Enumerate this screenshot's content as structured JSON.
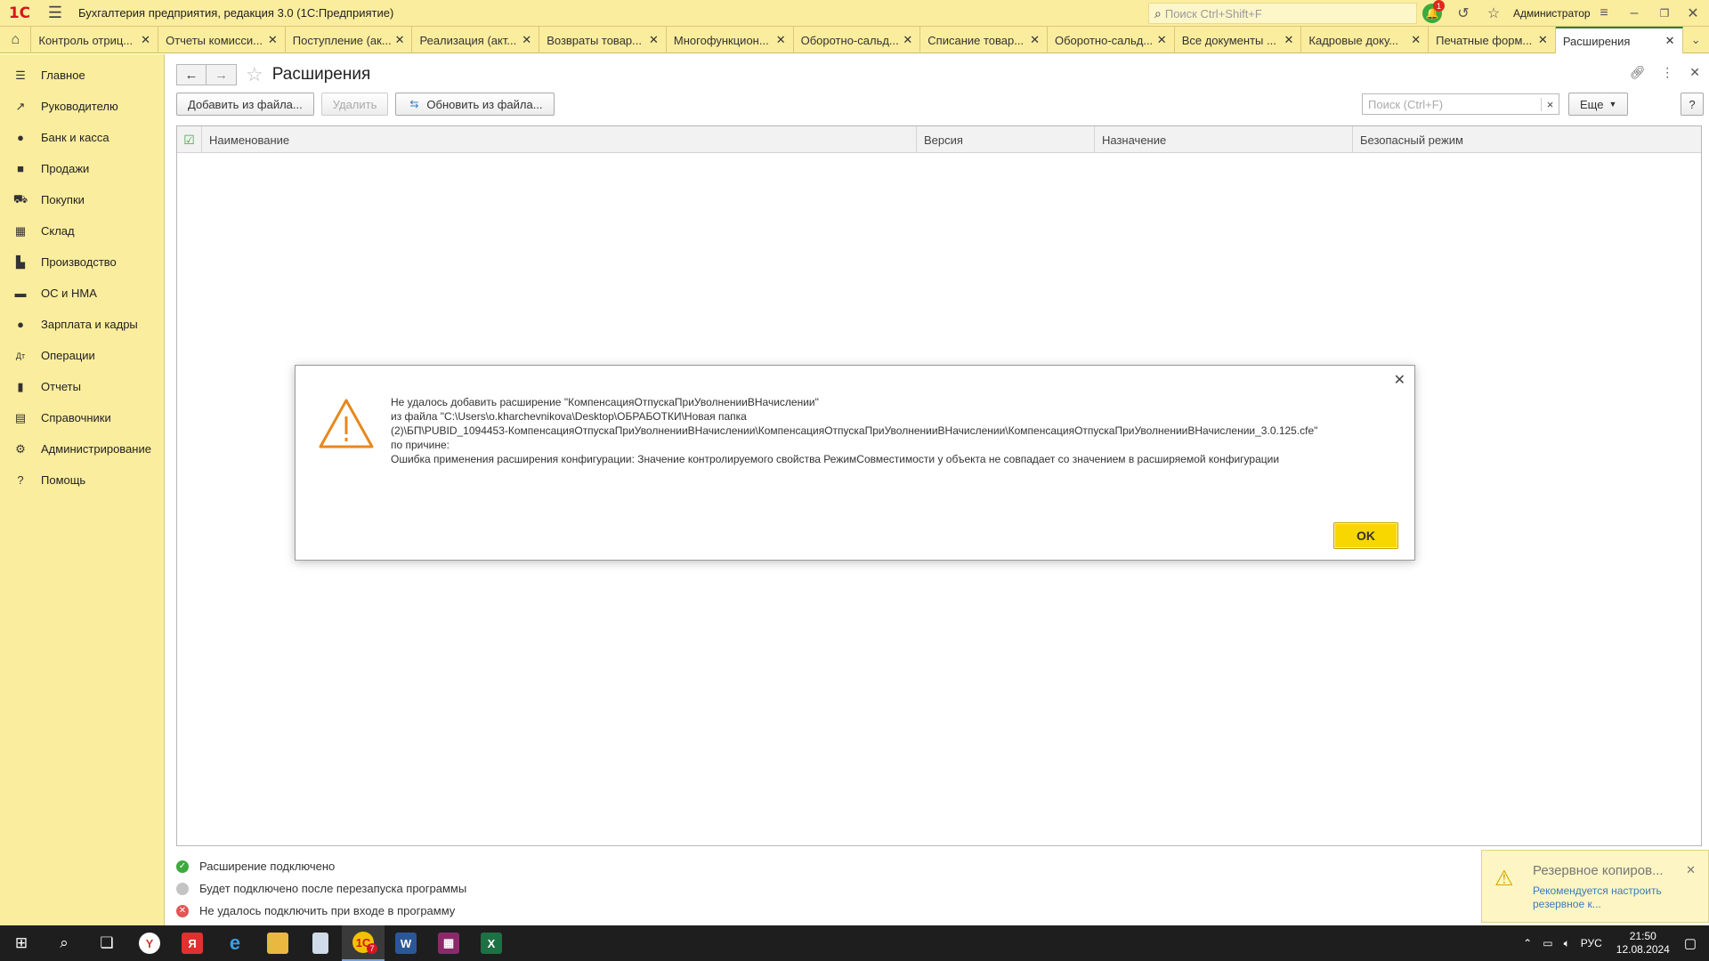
{
  "app": {
    "title": "Бухгалтерия предприятия, редакция 3.0  (1С:Предприятие)",
    "logo": "1С",
    "search_placeholder": "Поиск Ctrl+Shift+F",
    "user": "Администратор",
    "notifications_count": "1"
  },
  "tabs": [
    {
      "label": "Контроль отриц..."
    },
    {
      "label": "Отчеты комисси..."
    },
    {
      "label": "Поступление (ак..."
    },
    {
      "label": "Реализация (акт..."
    },
    {
      "label": "Возвраты товар..."
    },
    {
      "label": "Многофункцион..."
    },
    {
      "label": "Оборотно-сальд..."
    },
    {
      "label": "Списание товар..."
    },
    {
      "label": "Оборотно-сальд..."
    },
    {
      "label": "Все документы ..."
    },
    {
      "label": "Кадровые доку..."
    },
    {
      "label": "Печатные форм..."
    },
    {
      "label": "Расширения"
    }
  ],
  "sidebar": [
    {
      "label": "Главное",
      "icon": "menu-icon"
    },
    {
      "label": "Руководителю",
      "icon": "chart-trend-icon"
    },
    {
      "label": "Банк и касса",
      "icon": "coin-icon"
    },
    {
      "label": "Продажи",
      "icon": "bag-icon"
    },
    {
      "label": "Покупки",
      "icon": "cart-icon"
    },
    {
      "label": "Склад",
      "icon": "warehouse-icon"
    },
    {
      "label": "Производство",
      "icon": "factory-icon"
    },
    {
      "label": "ОС и НМА",
      "icon": "truck-icon"
    },
    {
      "label": "Зарплата и кадры",
      "icon": "person-icon"
    },
    {
      "label": "Операции",
      "icon": "dt-kt-icon"
    },
    {
      "label": "Отчеты",
      "icon": "bar-chart-icon"
    },
    {
      "label": "Справочники",
      "icon": "book-icon"
    },
    {
      "label": "Администрирование",
      "icon": "gear-icon"
    },
    {
      "label": "Помощь",
      "icon": "question-icon"
    }
  ],
  "form": {
    "title": "Расширения",
    "buttons": {
      "add": "Добавить из файла...",
      "delete": "Удалить",
      "update": "Обновить из файла...",
      "more": "Еще",
      "help": "?"
    },
    "search_placeholder": "Поиск (Ctrl+F)",
    "columns": [
      "Наименование",
      "Версия",
      "Назначение",
      "Безопасный режим"
    ],
    "legend": [
      {
        "label": "Расширение подключено",
        "color": "#3caa3c"
      },
      {
        "label": "Будет подключено после перезапуска программы",
        "color": "#c4c4c4"
      },
      {
        "label": "Не удалось подключить при входе в программу",
        "color": "#e25555"
      }
    ]
  },
  "dialog": {
    "lines": [
      "Не удалось добавить расширение \"КомпенсацияОтпускаПриУволненииВНачислении\"",
      "из файла \"C:\\Users\\o.kharchevnikova\\Desktop\\ОБРАБОТКИ\\Новая папка",
      "(2)\\БП\\PUBID_1094453-КомпенсацияОтпускаПриУволненииВНачислении\\КомпенсацияОтпускаПриУволненииВНачислении\\КомпенсацияОтпускаПриУволненииВНачислении_3.0.125.cfe\"",
      "по причине:",
      "Ошибка применения расширения конфигурации: Значение контролируемого свойства РежимСовместимости у объекта  не совпадает со значением в расширяемой конфигурации"
    ],
    "ok": "OK"
  },
  "notification": {
    "title": "Резервное копиров...",
    "text": "Рекомендуется настроить резервное к..."
  },
  "taskbar": {
    "lang": "РУС",
    "time": "21:50",
    "date": "12.08.2024",
    "badge": "7"
  }
}
